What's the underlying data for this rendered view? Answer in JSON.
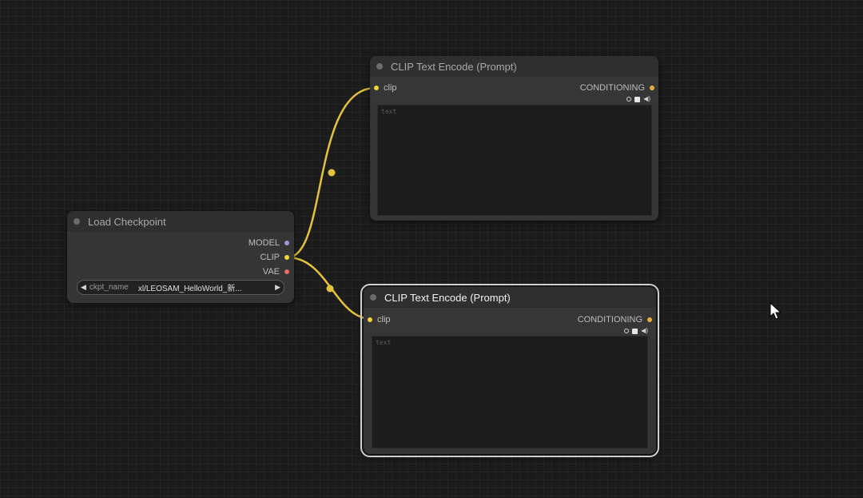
{
  "nodes": {
    "load_checkpoint": {
      "title": "Load Checkpoint",
      "outputs": {
        "model": {
          "label": "MODEL",
          "color": "#9e9bd8"
        },
        "clip": {
          "label": "CLIP",
          "color": "#f2d33c"
        },
        "vae": {
          "label": "VAE",
          "color": "#e86a6a"
        }
      },
      "widget": {
        "name": "ckpt_name",
        "value": "xl/LEOSAM_HelloWorld_新..."
      }
    },
    "clip_text_encode_top": {
      "title": "CLIP Text Encode (Prompt)",
      "input_label": "clip",
      "output_label": "CONDITIONING",
      "text_placeholder": "text"
    },
    "clip_text_encode_bottom": {
      "title": "CLIP Text Encode (Prompt)",
      "input_label": "clip",
      "output_label": "CONDITIONING",
      "text_placeholder": "text"
    }
  },
  "colors": {
    "link_clip": "#e4c23e",
    "conditioning": "#ecab3d",
    "background": "#1b1b1b"
  }
}
